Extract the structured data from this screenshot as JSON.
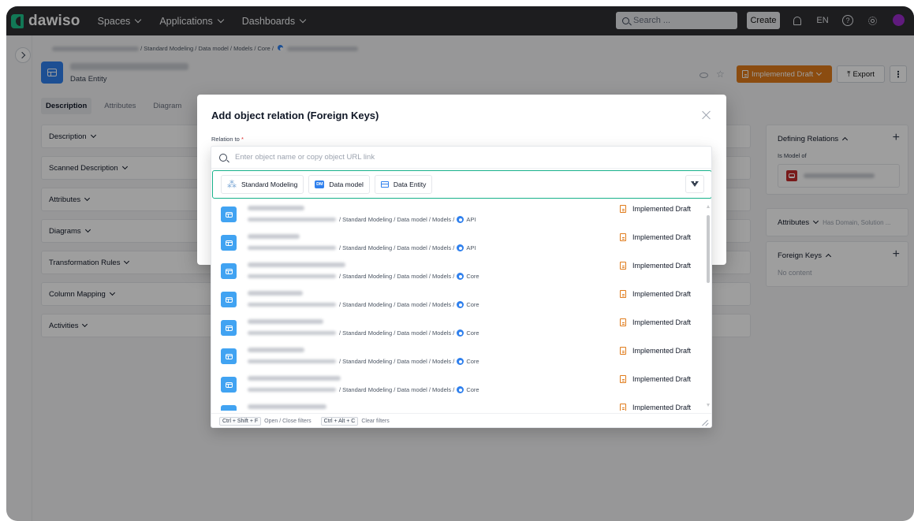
{
  "topbar": {
    "brand": "dawiso",
    "nav": [
      "Spaces",
      "Applications",
      "Dashboards"
    ],
    "search_placeholder": "Search ...",
    "create_label": "Create",
    "language": "EN"
  },
  "page": {
    "breadcrumb": "/ Standard Modeling / Data model / Models / Core /",
    "entity_type": "Data Entity",
    "tabs": [
      "Description",
      "Attributes",
      "Diagram"
    ],
    "status_button": "Implemented Draft",
    "export_label": "Export",
    "sections": [
      "Description",
      "Scanned Description",
      "Attributes",
      "Diagrams",
      "Transformation Rules",
      "Column Mapping",
      "Activities"
    ],
    "right_panel": {
      "defining_relations": "Defining Relations",
      "is_model_of": "Is Model of",
      "attributes": "Attributes",
      "attributes_hint": "Has Domain, Solution ...",
      "foreign_keys": "Foreign Keys",
      "no_content": "No content"
    }
  },
  "dialog": {
    "title": "Add object relation (Foreign Keys)",
    "relation_label": "Relation to",
    "required_mark": "*"
  },
  "picker": {
    "search_placeholder": "Enter object name or copy object URL link",
    "filters": [
      {
        "label": "Standard Modeling",
        "icon": "standard-modeling-icon"
      },
      {
        "label": "Data model",
        "icon": "data-model-icon",
        "badge": "DM"
      },
      {
        "label": "Data Entity",
        "icon": "data-entity-icon"
      }
    ],
    "rows": [
      {
        "path": "/ Standard Modeling / Data model / Models /",
        "leaf": "API",
        "status": "Implemented Draft"
      },
      {
        "path": "/ Standard Modeling / Data model / Models /",
        "leaf": "API",
        "status": "Implemented Draft"
      },
      {
        "path": "/ Standard Modeling / Data model / Models /",
        "leaf": "Core",
        "status": "Implemented Draft"
      },
      {
        "path": "/ Standard Modeling / Data model / Models /",
        "leaf": "Core",
        "status": "Implemented Draft"
      },
      {
        "path": "/ Standard Modeling / Data model / Models /",
        "leaf": "Core",
        "status": "Implemented Draft"
      },
      {
        "path": "/ Standard Modeling / Data model / Models /",
        "leaf": "Core",
        "status": "Implemented Draft"
      },
      {
        "path": "/ Standard Modeling / Data model / Models /",
        "leaf": "Core",
        "status": "Implemented Draft"
      },
      {
        "path": "",
        "leaf": "",
        "status": "Implemented Draft"
      }
    ],
    "shortcuts": [
      {
        "keys": "Ctrl + Shift + F",
        "desc": "Open / Close filters"
      },
      {
        "keys": "Ctrl + Alt + C",
        "desc": "Clear filters"
      }
    ]
  },
  "colors": {
    "topbar": "#2f2f33",
    "brand_green": "#1ec28b",
    "status_orange": "#e07b1a",
    "filter_border": "#17b18a",
    "entity_blue": "#2f80ed"
  }
}
